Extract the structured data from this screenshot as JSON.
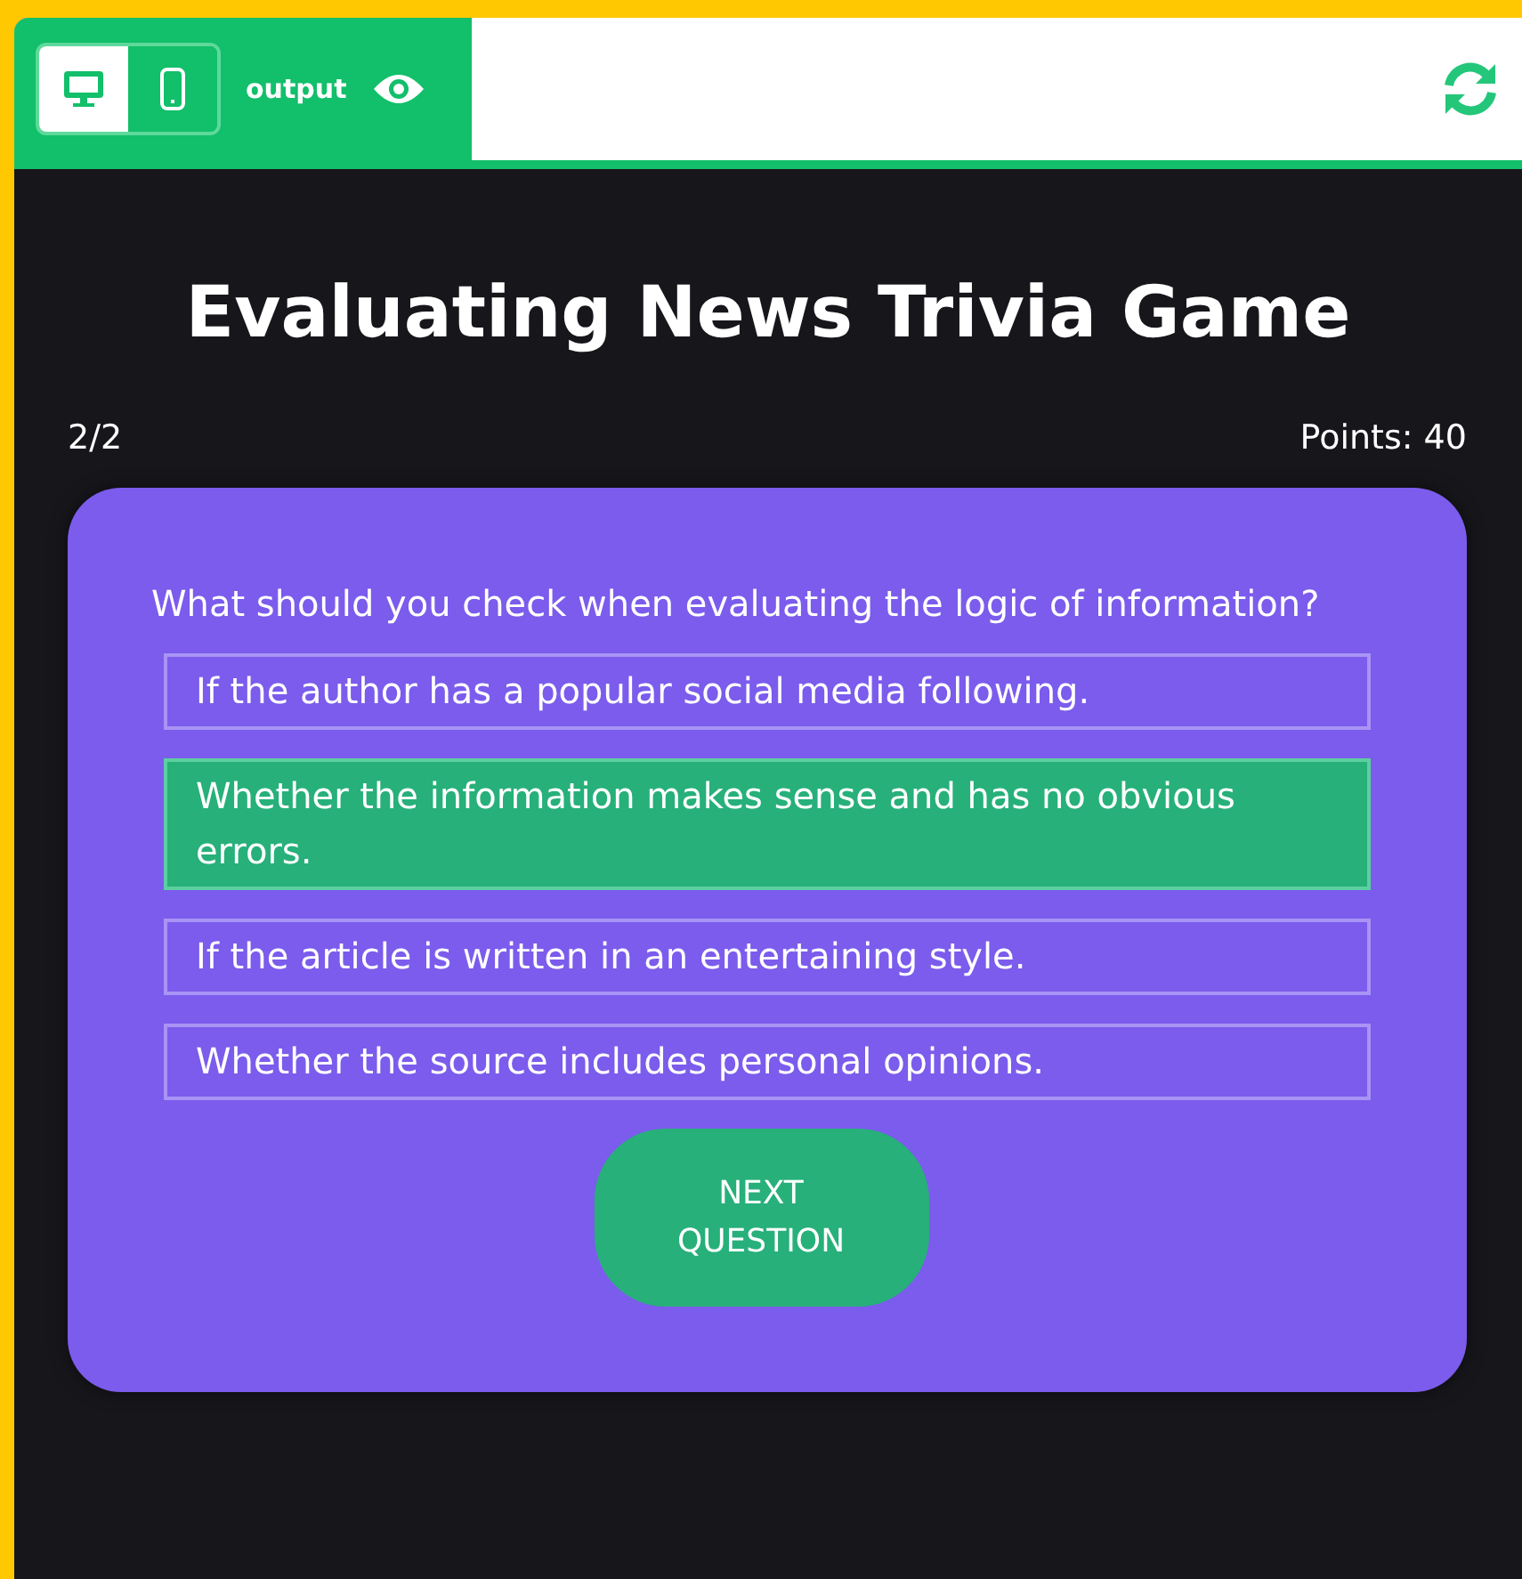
{
  "toolbar": {
    "views": [
      {
        "kind": "desktop",
        "selected": true
      },
      {
        "kind": "mobile",
        "selected": false
      }
    ],
    "label": "output"
  },
  "game": {
    "title": "Evaluating News Trivia Game",
    "progress": "2/2",
    "points": "Points: 40",
    "question": "What should you check when evaluating the logic of information?",
    "options": [
      {
        "text": "If the author has a popular social media following.",
        "selected": false
      },
      {
        "text": "Whether the information makes sense and has no obvious errors.",
        "selected": true
      },
      {
        "text": "If the article is written in an entertaining style.",
        "selected": false
      },
      {
        "text": "Whether the source includes personal opinions.",
        "selected": false
      }
    ],
    "next_button": "NEXT QUESTION"
  }
}
